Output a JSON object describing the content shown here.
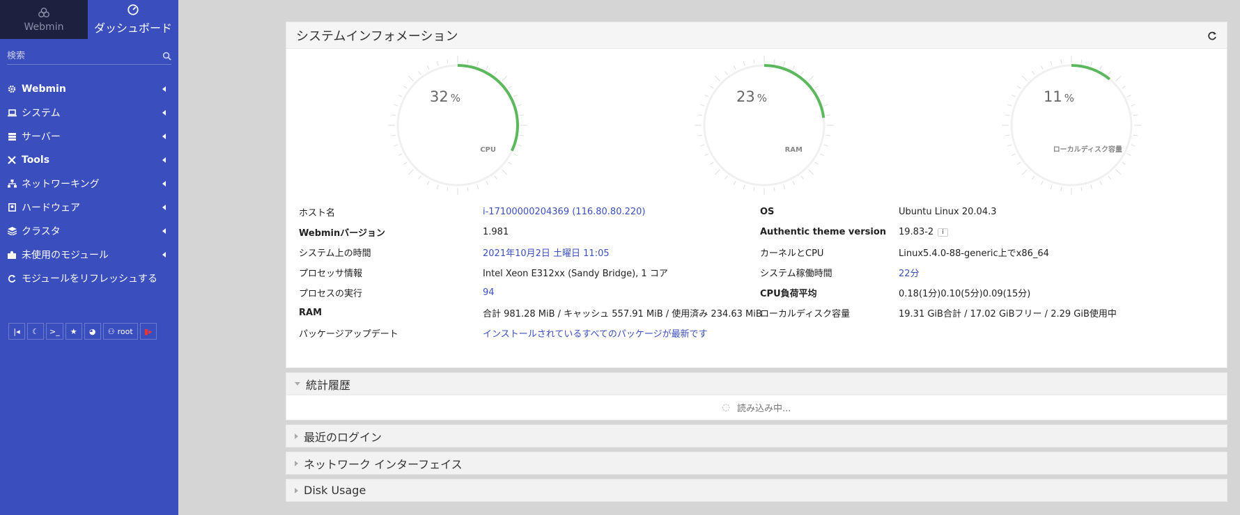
{
  "sidebar": {
    "tabs": [
      {
        "label": "Webmin",
        "icon": "webmin-logo-icon",
        "active": false
      },
      {
        "label": "ダッシュボード",
        "icon": "dashboard-icon",
        "active": true
      }
    ],
    "search_placeholder": "検索",
    "items": [
      {
        "label": "Webmin",
        "icon": "gear-icon"
      },
      {
        "label": "システム",
        "icon": "laptop-icon"
      },
      {
        "label": "サーバー",
        "icon": "server-icon"
      },
      {
        "label": "Tools",
        "icon": "tools-icon"
      },
      {
        "label": "ネットワーキング",
        "icon": "network-icon"
      },
      {
        "label": "ハードウェア",
        "icon": "hardware-icon"
      },
      {
        "label": "クラスタ",
        "icon": "layers-icon"
      },
      {
        "label": "未使用のモジュール",
        "icon": "puzzle-icon"
      },
      {
        "label": "モジュールをリフレッシュする",
        "icon": "refresh-icon"
      }
    ],
    "bottom_user": "root",
    "accent": "#3a4fbd"
  },
  "sysinfo": {
    "title": "システムインフォメーション",
    "gauges": [
      {
        "value": 32,
        "unit": "%",
        "label": "CPU"
      },
      {
        "value": 23,
        "unit": "%",
        "label": "RAM"
      },
      {
        "value": 11,
        "unit": "%",
        "label": "ローカルディスク容量"
      }
    ],
    "gauge_color": "#5cb85c",
    "left": [
      {
        "k": "ホスト名",
        "v": "i-17100000204369 (116.80.80.220)",
        "link": true,
        "kbold": false
      },
      {
        "k": "Webminバージョン",
        "v": "1.981",
        "link": false,
        "kbold": true
      },
      {
        "k": "システム上の時間",
        "v": "2021年10月2日 土曜日 11:05",
        "link": true,
        "kbold": false
      },
      {
        "k": "プロセッサ情報",
        "v": "Intel Xeon E312xx (Sandy Bridge), 1 コア",
        "link": false,
        "kbold": false
      },
      {
        "k": "プロセスの実行",
        "v": "94",
        "link": true,
        "kbold": false
      },
      {
        "k": "RAM",
        "v": "合計 981.28 MiB / キャッシュ 557.91 MiB / 使用済み 234.63 MiB",
        "link": false,
        "kbold": true
      },
      {
        "k": "パッケージアップデート",
        "v": "インストールされているすべてのパッケージが最新です",
        "link": true,
        "kbold": false
      }
    ],
    "right": [
      {
        "k": "OS",
        "v": "Ubuntu Linux 20.04.3",
        "link": false,
        "kbold": true
      },
      {
        "k": "Authentic theme version",
        "v": "19.83-2",
        "link": false,
        "kbold": true
      },
      {
        "k": "カーネルとCPU",
        "v": "Linux5.4.0-88-generic上でx86_64",
        "link": false,
        "kbold": false
      },
      {
        "k": "システム稼働時間",
        "v": "22分",
        "link": true,
        "kbold": false
      },
      {
        "k": "CPU負荷平均",
        "v": "0.18(1分)0.10(5分)0.09(15分)",
        "link": false,
        "kbold": true
      },
      {
        "k": "ローカルディスク容量",
        "v": "19.31 GiB合計 / 17.02 GiBフリー / 2.29 GiB使用中",
        "link": false,
        "kbold": false
      }
    ]
  },
  "sections": {
    "stats": {
      "label": "統計履歴",
      "loading": "読み込み中..."
    },
    "logins": {
      "label": "最近のログイン"
    },
    "network": {
      "label": "ネットワーク インターフェイス"
    },
    "disk": {
      "label": "Disk Usage"
    }
  }
}
